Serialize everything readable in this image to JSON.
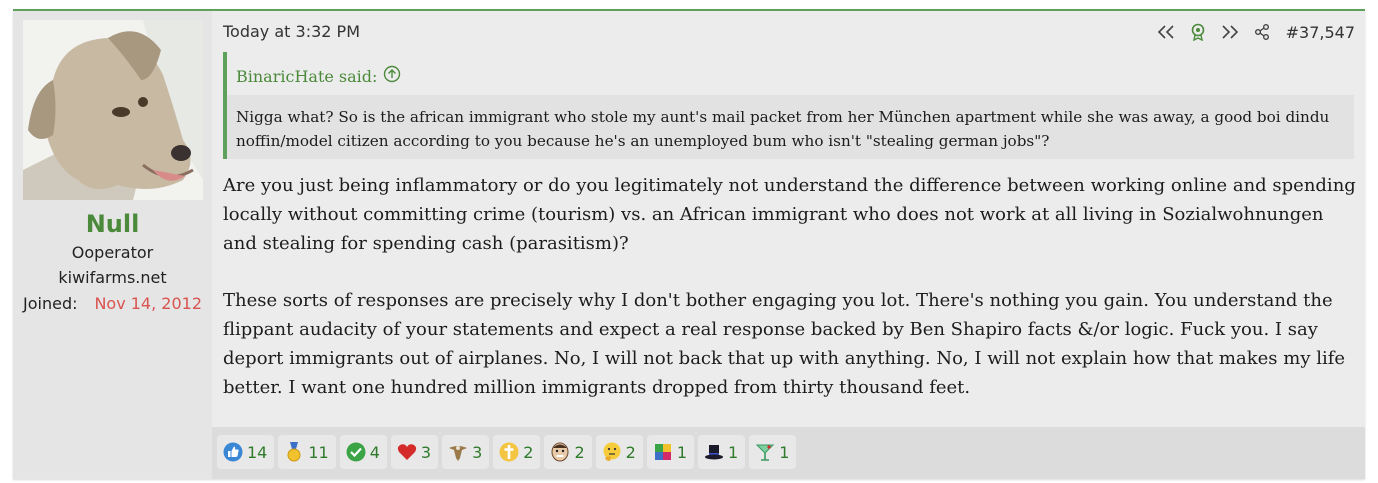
{
  "user": {
    "name": "Null",
    "title": "Ooperator",
    "site": "kiwifarms.net",
    "joined_label": "Joined:",
    "joined_value": "Nov 14, 2012"
  },
  "post": {
    "timestamp": "Today at 3:32 PM",
    "number": "#37,547",
    "icons": [
      "rewind-icon",
      "award-icon",
      "fast-forward-icon",
      "share-icon"
    ]
  },
  "quote": {
    "author": "BinaricHate said:",
    "text": "Nigga what? So is the african immigrant who stole my aunt's mail packet from her München apartment while she was away, a good boi dindu noffin/model citizen according to you because he's an unemployed bum who isn't \"stealing german jobs\"?"
  },
  "content": {
    "paragraphs": [
      "Are you just being inflammatory or do you legitimately not understand the difference between working online and spending locally without committing crime (tourism) vs. an African immigrant who does not work at all living in Sozialwohnungen and stealing for spending cash (parasitism)?",
      "These sorts of responses are precisely why I don't bother engaging you lot. There's nothing you gain. You understand the flippant audacity of your statements and expect a real response backed by Ben Shapiro facts &/or logic. Fuck you. I say deport immigrants out of airplanes. No, I will not back that up with anything. No, I will not explain how that makes my life better. I want one hundred million immigrants dropped from thirty thousand feet."
    ]
  },
  "reactions": [
    {
      "icon": "thumbs-up-icon",
      "count": "14"
    },
    {
      "icon": "medal-icon",
      "count": "11"
    },
    {
      "icon": "check-icon",
      "count": "4"
    },
    {
      "icon": "heart-icon",
      "count": "3"
    },
    {
      "icon": "eagle-icon",
      "count": "3"
    },
    {
      "icon": "cross-icon",
      "count": "2"
    },
    {
      "icon": "face-icon",
      "count": "2"
    },
    {
      "icon": "thinking-icon",
      "count": "2"
    },
    {
      "icon": "puzzle-icon",
      "count": "1"
    },
    {
      "icon": "top-hat-icon",
      "count": "1"
    },
    {
      "icon": "cocktail-icon",
      "count": "1"
    }
  ]
}
